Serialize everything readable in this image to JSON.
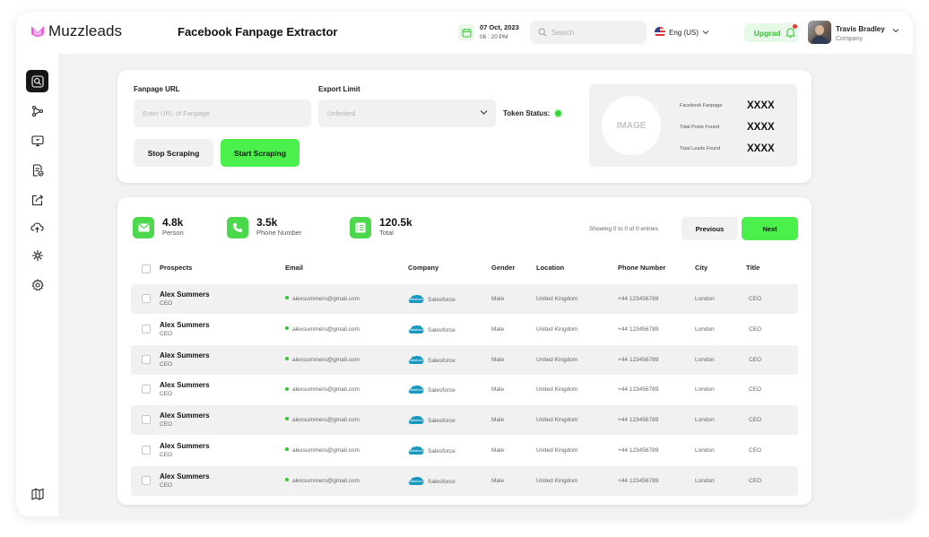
{
  "brand": {
    "logo_text": "Muzzleads",
    "accent_color": "#4cf04c",
    "logo_color": "#e44bd4"
  },
  "header": {
    "title": "Facebook Fanpage Extractor",
    "date": "07 Oct, 2023",
    "time": "06 : 20 PM",
    "search_placeholder": "Search",
    "language": "Eng (US)",
    "upgrade_label": "Upgrade",
    "user_name": "Travis Bradley",
    "user_role": "Company"
  },
  "sidebar": {
    "items": [
      {
        "icon": "search-icon",
        "active": true
      },
      {
        "icon": "network-icon",
        "active": false
      },
      {
        "icon": "monitor-icon",
        "active": false
      },
      {
        "icon": "document-check-icon",
        "active": false
      },
      {
        "icon": "export-icon",
        "active": false
      },
      {
        "icon": "cloud-upload-icon",
        "active": false
      },
      {
        "icon": "hub-icon",
        "active": false
      },
      {
        "icon": "settings-icon",
        "active": false
      },
      {
        "icon": "map-icon",
        "active": false
      }
    ]
  },
  "form": {
    "fanpage_label": "Fanpage URL",
    "fanpage_placeholder": "Enter URL of Fanpage",
    "export_label": "Export Limit",
    "export_value": "Unlimited",
    "token_label": "Token Status:",
    "stop_label": "Stop Scraping",
    "start_label": "Start Scraping"
  },
  "info": {
    "image_placeholder": "IMAGE",
    "rows": [
      {
        "key": "Facebook Fanpage",
        "value": "XXXX"
      },
      {
        "key": "Total Posts Found",
        "value": "XXXX"
      },
      {
        "key": "Total Leads Found",
        "value": "XXXX"
      }
    ]
  },
  "stats": [
    {
      "value": "4.8k",
      "label": "Person",
      "icon": "mail-icon"
    },
    {
      "value": "3.5k",
      "label": "Phone Number",
      "icon": "phone-icon"
    },
    {
      "value": "120.5k",
      "label": "Total",
      "icon": "list-icon"
    }
  ],
  "pagination": {
    "entries_text": "Showing 0 to 0 of 0 entries",
    "previous_label": "Previous",
    "next_label": "Next"
  },
  "table": {
    "columns": [
      "Prospects",
      "Email",
      "Company",
      "Gender",
      "Location",
      "Phone Number",
      "City",
      "Title"
    ],
    "rows": [
      {
        "name": "Alex Summers",
        "role": "CEO",
        "email": "alexsummers@gmail.com",
        "company": "Salesforce",
        "gender": "Male",
        "location": "United Kingdom",
        "phone": "+44 123456789",
        "city": "London",
        "title": "CEO"
      },
      {
        "name": "Alex Summers",
        "role": "CEO",
        "email": "alexsummers@gmail.com",
        "company": "Salesforce",
        "gender": "Male",
        "location": "United Kingdom",
        "phone": "+44 123456789",
        "city": "London",
        "title": "CEO"
      },
      {
        "name": "Alex Summers",
        "role": "CEO",
        "email": "alexsummers@gmail.com",
        "company": "Salesforce",
        "gender": "Male",
        "location": "United Kingdom",
        "phone": "+44 123456789",
        "city": "London",
        "title": "CEO"
      },
      {
        "name": "Alex Summers",
        "role": "CEO",
        "email": "alexsummers@gmail.com",
        "company": "Salesforce",
        "gender": "Male",
        "location": "United Kingdom",
        "phone": "+44 123456789",
        "city": "London",
        "title": "CEO"
      },
      {
        "name": "Alex Summers",
        "role": "CEO",
        "email": "alexsummers@gmail.com",
        "company": "Salesforce",
        "gender": "Male",
        "location": "United Kingdom",
        "phone": "+44 123456789",
        "city": "London",
        "title": "CEO"
      },
      {
        "name": "Alex Summers",
        "role": "CEO",
        "email": "alexsummers@gmail.com",
        "company": "Salesforce",
        "gender": "Male",
        "location": "United Kingdom",
        "phone": "+44 123456789",
        "city": "London",
        "title": "CEO"
      },
      {
        "name": "Alex Summers",
        "role": "CEO",
        "email": "alexsummers@gmail.com",
        "company": "Salesforce",
        "gender": "Male",
        "location": "United Kingdom",
        "phone": "+44 123456789",
        "city": "London",
        "title": "CEO"
      }
    ]
  }
}
